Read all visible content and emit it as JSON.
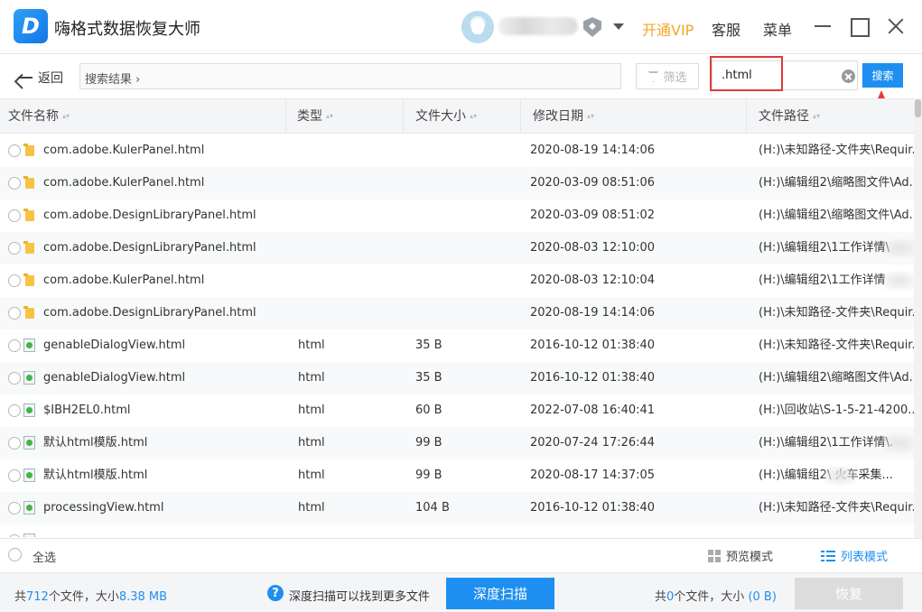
{
  "app": {
    "title": "嗨格式数据恢复大师",
    "logo_letter": "D",
    "vip_label": "开通VIP",
    "service_label": "客服",
    "menu_label": "菜单",
    "accent_color": "#1e8ff0",
    "vip_color": "#f5a623"
  },
  "toolbar": {
    "back_label": "返回",
    "breadcrumb": "搜索结果 ›",
    "filter_label": "筛选",
    "search_value": ".html",
    "search_button": "搜索"
  },
  "columns": {
    "name": "文件名称",
    "type": "类型",
    "size": "文件大小",
    "date": "修改日期",
    "path": "文件路径",
    "sort_glyph": "▴▾"
  },
  "rows": [
    {
      "icon": "folder",
      "name": "com.adobe.KulerPanel.html",
      "type": "",
      "size": "",
      "date": "2020-08-19 14:14:06",
      "path": "(H:)\\未知路径-文件夹\\Requir..."
    },
    {
      "icon": "folder",
      "name": "com.adobe.KulerPanel.html",
      "type": "",
      "size": "",
      "date": "2020-03-09 08:51:06",
      "path": "(H:)\\编辑组2\\缩略图文件\\Ad..."
    },
    {
      "icon": "folder",
      "name": "com.adobe.DesignLibraryPanel.html",
      "type": "",
      "size": "",
      "date": "2020-03-09 08:51:02",
      "path": "(H:)\\编辑组2\\缩略图文件\\Ad..."
    },
    {
      "icon": "folder",
      "name": "com.adobe.DesignLibraryPanel.html",
      "type": "",
      "size": "",
      "date": "2020-08-03 12:10:00",
      "path": "(H:)\\编辑组2\\1工作详情\\"
    },
    {
      "icon": "folder",
      "name": "com.adobe.KulerPanel.html",
      "type": "",
      "size": "",
      "date": "2020-08-03 12:10:04",
      "path": "(H:)\\编辑组2\\1工作详情"
    },
    {
      "icon": "folder",
      "name": "com.adobe.DesignLibraryPanel.html",
      "type": "",
      "size": "",
      "date": "2020-08-19 14:14:06",
      "path": "(H:)\\未知路径-文件夹\\Requir..."
    },
    {
      "icon": "html",
      "name": "genableDialogView.html",
      "type": "html",
      "size": "35 B",
      "date": "2016-10-12 01:38:40",
      "path": "(H:)\\未知路径-文件夹\\Requir..."
    },
    {
      "icon": "html",
      "name": "genableDialogView.html",
      "type": "html",
      "size": "35 B",
      "date": "2016-10-12 01:38:40",
      "path": "(H:)\\编辑组2\\缩略图文件\\Ad..."
    },
    {
      "icon": "html",
      "name": "$IBH2EL0.html",
      "type": "html",
      "size": "60 B",
      "date": "2022-07-08 16:40:41",
      "path": "(H:)\\回收站\\S-1-5-21-4200..."
    },
    {
      "icon": "html",
      "name": "默认html模版.html",
      "type": "html",
      "size": "99 B",
      "date": "2020-07-24 17:26:44",
      "path": "(H:)\\编辑组2\\1工作详情\\."
    },
    {
      "icon": "html",
      "name": "默认html模版.html",
      "type": "html",
      "size": "99 B",
      "date": "2020-08-17 14:37:05",
      "path": "(H:)\\编辑组2\\        火车采集..."
    },
    {
      "icon": "html",
      "name": "processingView.html",
      "type": "html",
      "size": "104 B",
      "date": "2016-10-12 01:38:40",
      "path": "(H:)\\未知路径-文件夹\\Requir..."
    }
  ],
  "select_bar": {
    "select_all": "全选",
    "preview_mode": "预览模式",
    "list_mode": "列表模式"
  },
  "status": {
    "total_prefix": "共",
    "total_count": "712",
    "total_mid": "个文件，大小",
    "total_size": "8.38 MB",
    "tip_icon": "?",
    "tip": "深度扫描可以找到更多文件",
    "deep_scan": "深度扫描",
    "selected_prefix": "共",
    "selected_count": "0",
    "selected_mid": "个文件，大小",
    "selected_size": "(0 B)",
    "recover": "恢复"
  }
}
